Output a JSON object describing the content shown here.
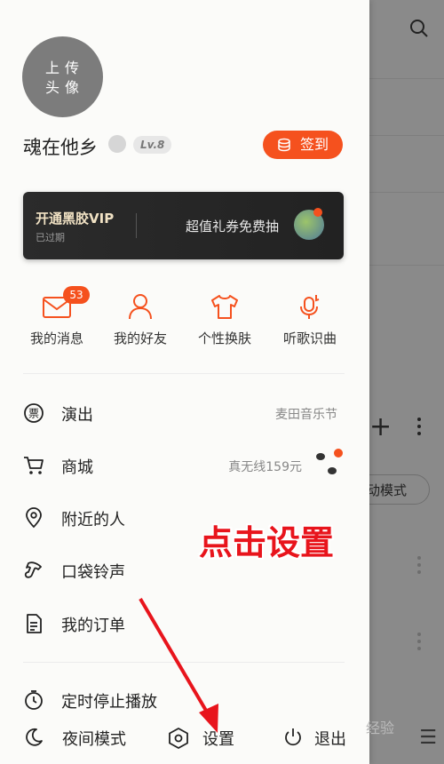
{
  "drawer": {
    "avatar_text": "上 传\n头 像",
    "avatar_line1": "上传",
    "avatar_line2": "头像",
    "username": "魂在他乡",
    "level": "Lv.8",
    "checkin_label": "签到",
    "vip_card": {
      "title": "开通黑胶VIP",
      "status": "已过期",
      "promo": "超值礼券免费抽"
    },
    "quick_actions": [
      {
        "label": "我的消息",
        "icon": "mail-icon",
        "badge": "53"
      },
      {
        "label": "我的好友",
        "icon": "person-icon"
      },
      {
        "label": "个性换肤",
        "icon": "tshirt-icon"
      },
      {
        "label": "听歌识曲",
        "icon": "mic-music-icon"
      }
    ],
    "menu": [
      {
        "label": "演出",
        "icon": "ticket-icon",
        "right": "麦田音乐节"
      },
      {
        "label": "商城",
        "icon": "cart-icon",
        "right": "真无线159元"
      },
      {
        "label": "附近的人",
        "icon": "location-pin-icon",
        "right": ""
      },
      {
        "label": "口袋铃声",
        "icon": "ringtone-icon",
        "right": ""
      },
      {
        "label": "我的订单",
        "icon": "order-doc-icon",
        "right": ""
      },
      {
        "label": "定时停止播放",
        "icon": "timer-icon",
        "right": ""
      }
    ],
    "bottom_bar": {
      "night_mode": "夜间模式",
      "settings": "设置",
      "exit": "退出"
    }
  },
  "background_page": {
    "chip_label": "动模式"
  },
  "annotation": {
    "text": "点击设置"
  },
  "watermark": "经验",
  "colors": {
    "accent": "#f5511e",
    "annotation": "#e8141c",
    "vip_card_bg": "#262626"
  }
}
